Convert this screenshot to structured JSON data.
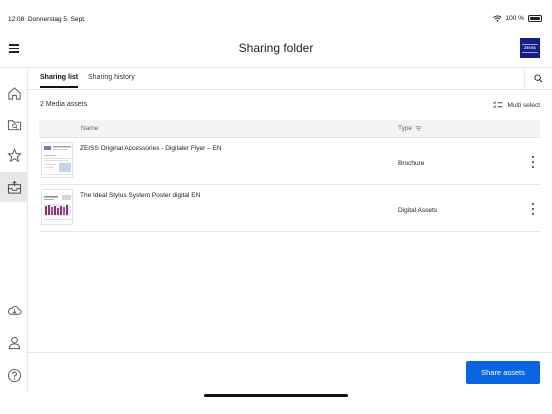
{
  "status_bar": {
    "time": "12:08",
    "date": "Donnerstag 5. Sept.",
    "battery": "100 %",
    "icons": [
      "wifi-icon",
      "battery-icon"
    ]
  },
  "header": {
    "title": "Sharing folder",
    "logo_text": "ZEISS",
    "brand_color": "#141f8c"
  },
  "sidebar": {
    "items": [
      {
        "name": "home",
        "icon": "home-icon",
        "active": false
      },
      {
        "name": "browse",
        "icon": "folder-search-icon",
        "active": false
      },
      {
        "name": "favorites",
        "icon": "star-icon",
        "active": false
      },
      {
        "name": "sharing",
        "icon": "share-tray-icon",
        "active": true
      },
      {
        "name": "offline",
        "icon": "cloud-download-icon",
        "active": false
      },
      {
        "name": "profile",
        "icon": "user-icon",
        "active": false
      },
      {
        "name": "help",
        "icon": "help-icon",
        "active": false
      }
    ]
  },
  "tabs": [
    {
      "label": "Sharing list",
      "active": true
    },
    {
      "label": "Sharing history",
      "active": false
    }
  ],
  "list": {
    "count_label": "2 Media assets",
    "multiselect_label": "Multi select",
    "columns": {
      "name": "Name",
      "type": "Type"
    },
    "rows": [
      {
        "name": "ZEISS Original Accessories - Digitaler Flyer – EN",
        "type": "Brochure"
      },
      {
        "name": "The Ideal Stylus System Poster digital EN",
        "type": "Digital Assets"
      }
    ]
  },
  "footer": {
    "share_label": "Share assets",
    "accent_color": "#0a66e0"
  }
}
